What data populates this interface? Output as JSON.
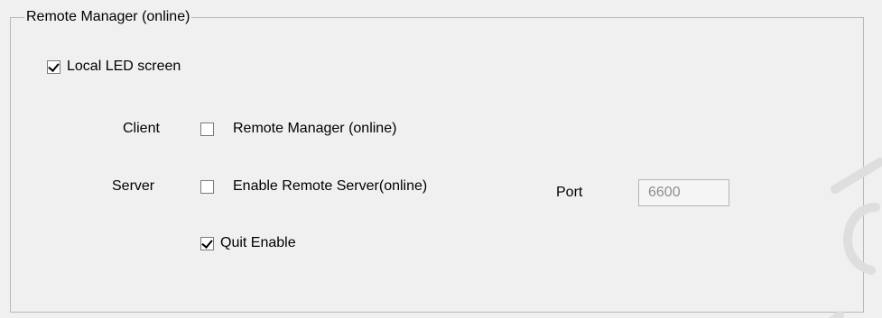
{
  "group": {
    "title": "Remote Manager (online)"
  },
  "local_led": {
    "label": "Local LED screen",
    "checked": true
  },
  "client": {
    "row_label": "Client",
    "checkbox_label": "Remote Manager (online)",
    "checked": false
  },
  "server": {
    "row_label": "Server",
    "checkbox_label": "Enable Remote Server(online)",
    "checked": false,
    "port_label": "Port",
    "port_value": "6600"
  },
  "quit": {
    "label": "Quit Enable",
    "checked": true
  },
  "colors": {
    "background": "#f0f0f0",
    "border": "#b9b9b9",
    "disabled_text": "#8e8e8e"
  }
}
